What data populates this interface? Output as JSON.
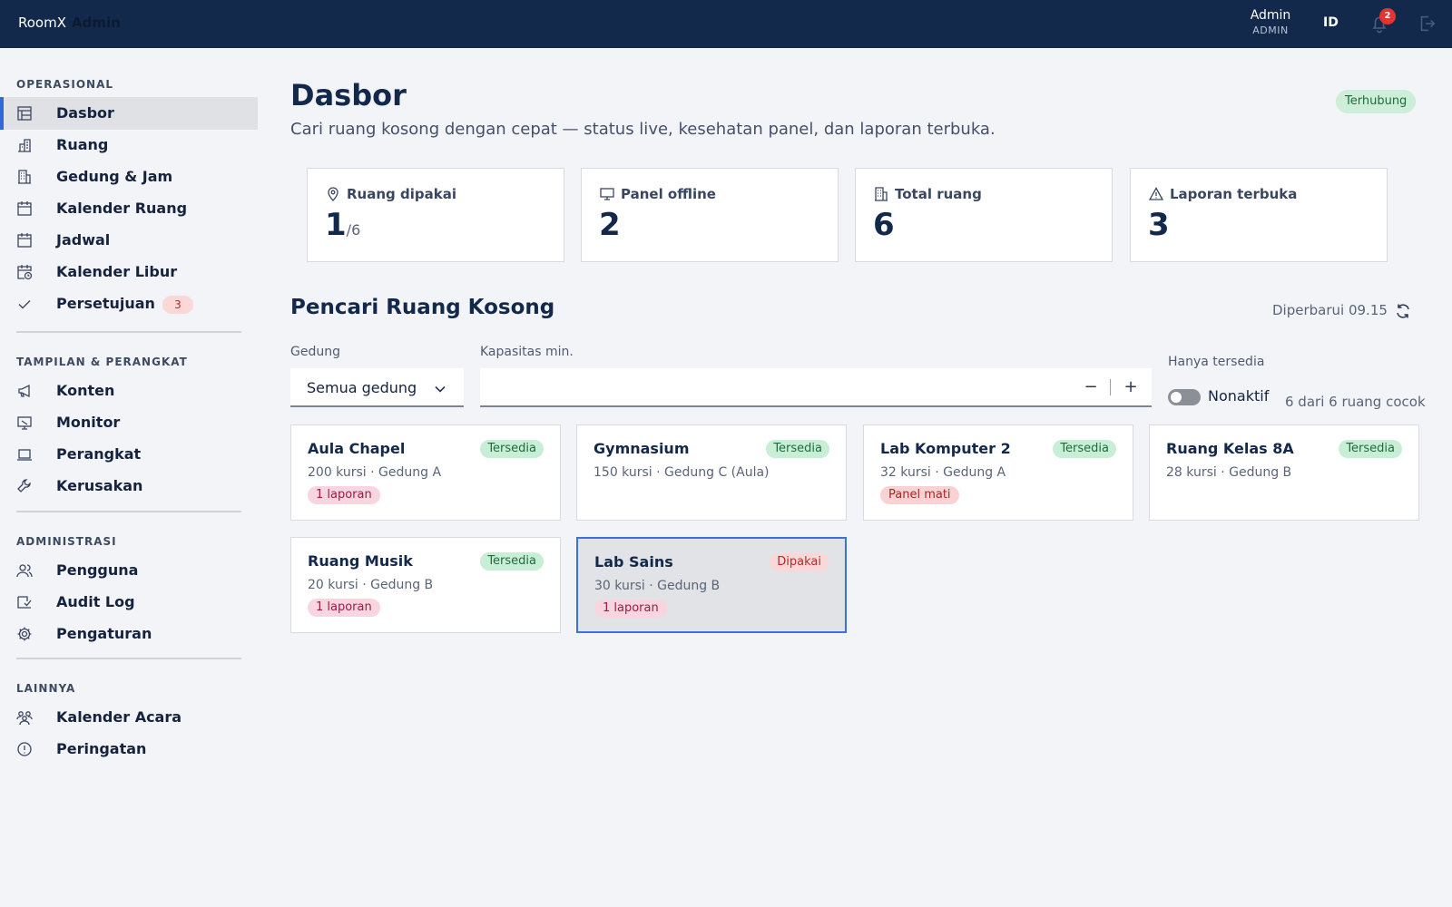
{
  "header": {
    "brand": "RoomX",
    "brand_suffix": "Admin",
    "user_name": "Admin",
    "user_role": "ADMIN",
    "language": "ID",
    "notification_count": "2",
    "colors": {
      "bar": "#13294b",
      "badge": "#e3342f"
    }
  },
  "sidebar": {
    "sections": [
      {
        "heading": "OPERASIONAL",
        "items": [
          {
            "label": "Dasbor",
            "icon": "dashboard-icon",
            "active": true
          },
          {
            "label": "Ruang",
            "icon": "room-icon"
          },
          {
            "label": "Gedung & Jam",
            "icon": "building-icon"
          },
          {
            "label": "Kalender Ruang",
            "icon": "calendar-icon"
          },
          {
            "label": "Jadwal",
            "icon": "calendar-icon"
          },
          {
            "label": "Kalender Libur",
            "icon": "calendar-clock-icon"
          },
          {
            "label": "Persetujuan",
            "icon": "check-icon",
            "badge": "3"
          }
        ]
      },
      {
        "heading": "TAMPILAN & PERANGKAT",
        "items": [
          {
            "label": "Konten",
            "icon": "megaphone-icon"
          },
          {
            "label": "Monitor",
            "icon": "monitor-icon"
          },
          {
            "label": "Perangkat",
            "icon": "laptop-icon"
          },
          {
            "label": "Kerusakan",
            "icon": "wrench-icon"
          }
        ]
      },
      {
        "heading": "ADMINISTRASI",
        "items": [
          {
            "label": "Pengguna",
            "icon": "users-icon"
          },
          {
            "label": "Audit Log",
            "icon": "audit-icon"
          },
          {
            "label": "Pengaturan",
            "icon": "gear-icon"
          }
        ]
      },
      {
        "heading": "LAINNYA",
        "items": [
          {
            "label": "Kalender Acara",
            "icon": "people-icon"
          },
          {
            "label": "Peringatan",
            "icon": "alert-circle-icon"
          }
        ]
      }
    ]
  },
  "main": {
    "title": "Dasbor",
    "subtitle": "Cari ruang kosong dengan cepat — status live, kesehatan panel, dan laporan terbuka.",
    "connection_status": "Terhubung",
    "stats": [
      {
        "label": "Ruang dipakai",
        "value": "1",
        "sub": "/6",
        "icon": "map-pin-icon"
      },
      {
        "label": "Panel offline",
        "value": "2",
        "sub": "",
        "icon": "monitor-icon"
      },
      {
        "label": "Total ruang",
        "value": "6",
        "sub": "",
        "icon": "building-icon"
      },
      {
        "label": "Laporan terbuka",
        "value": "3",
        "sub": "",
        "icon": "warning-icon"
      }
    ],
    "finder": {
      "title": "Pencari Ruang Kosong",
      "updated": "Diperbarui 09.15",
      "building_label": "Gedung",
      "building_value": "Semua gedung",
      "capacity_label": "Kapasitas min.",
      "capacity_value": "",
      "minus": "−",
      "plus": "+",
      "available_label": "Hanya tersedia",
      "toggle_state": "Nonaktif",
      "match_count": "6 dari 6 ruang cocok"
    },
    "rooms": [
      {
        "name": "Aula Chapel",
        "meta": "200 kursi · Gedung A",
        "status": "Tersedia",
        "status_kind": "ok",
        "flag": "1 laporan",
        "flag_kind": "report"
      },
      {
        "name": "Gymnasium",
        "meta": "150 kursi · Gedung C (Aula)",
        "status": "Tersedia",
        "status_kind": "ok",
        "flag": "",
        "flag_kind": ""
      },
      {
        "name": "Lab Komputer 2",
        "meta": "32 kursi · Gedung A",
        "status": "Tersedia",
        "status_kind": "ok",
        "flag": "Panel mati",
        "flag_kind": "panel"
      },
      {
        "name": "Ruang Kelas 8A",
        "meta": "28 kursi · Gedung B",
        "status": "Tersedia",
        "status_kind": "ok",
        "flag": "",
        "flag_kind": ""
      },
      {
        "name": "Ruang Musik",
        "meta": "20 kursi · Gedung B",
        "status": "Tersedia",
        "status_kind": "ok",
        "flag": "1 laporan",
        "flag_kind": "report"
      },
      {
        "name": "Lab Sains",
        "meta": "30 kursi · Gedung B",
        "status": "Dipakai",
        "status_kind": "busy",
        "flag": "1 laporan",
        "flag_kind": "report",
        "selected": true
      }
    ]
  }
}
